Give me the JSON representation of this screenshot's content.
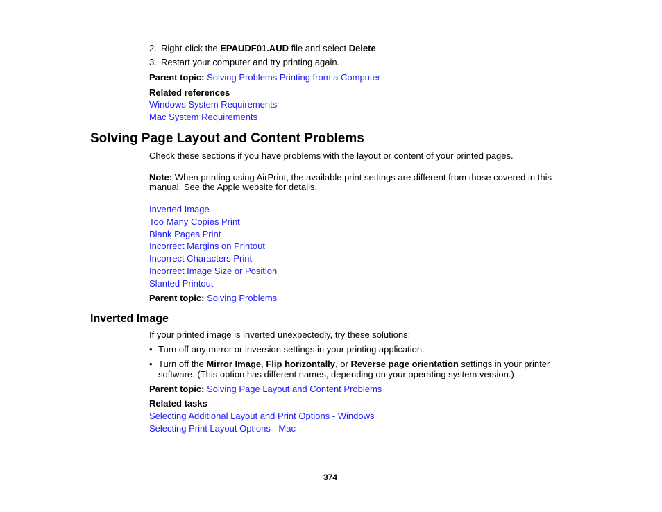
{
  "steps": [
    {
      "number": "2.",
      "pre": "Right-click the ",
      "bold1": "EPAUDF01.AUD",
      "mid": " file and select ",
      "bold2": "Delete",
      "post": "."
    },
    {
      "number": "3.",
      "text": "Restart your computer and try printing again."
    }
  ],
  "section0": {
    "parent_topic_label": "Parent topic:",
    "parent_topic_link": "Solving Problems Printing from a Computer",
    "related_heading": "Related references",
    "related_links": [
      "Windows System Requirements",
      "Mac System Requirements"
    ]
  },
  "section1": {
    "title": "Solving Page Layout and Content Problems",
    "intro": "Check these sections if you have problems with the layout or content of your printed pages.",
    "note_label": "Note:",
    "note_line1": " When printing using AirPrint, the available print settings are different from those covered in this",
    "note_line2": "manual. See the Apple website for details.",
    "links": [
      "Inverted Image",
      "Too Many Copies Print",
      "Blank Pages Print",
      "Incorrect Margins on Printout",
      "Incorrect Characters Print",
      "Incorrect Image Size or Position",
      "Slanted Printout"
    ],
    "parent_topic_label": "Parent topic:",
    "parent_topic_link": "Solving Problems"
  },
  "section2": {
    "title": "Inverted Image",
    "intro": "If your printed image is inverted unexpectedly, try these solutions:",
    "bullet_char": "•",
    "bullet1": "Turn off any mirror or inversion settings in your printing application.",
    "bullet2": {
      "pre": "Turn off the ",
      "bold1": "Mirror Image",
      "sep1": ", ",
      "bold2": "Flip horizontally",
      "sep2": ", or ",
      "bold3": "Reverse page orientation",
      "post": " settings in your printer",
      "line2": "software. (This option has different names, depending on your operating system version.)"
    },
    "parent_topic_label": "Parent topic:",
    "parent_topic_link": "Solving Page Layout and Content Problems",
    "related_heading": "Related tasks",
    "related_links": [
      "Selecting Additional Layout and Print Options - Windows",
      "Selecting Print Layout Options - Mac"
    ]
  },
  "page_number": "374",
  "colors": {
    "link": "#1a1aff",
    "text": "#000000"
  }
}
